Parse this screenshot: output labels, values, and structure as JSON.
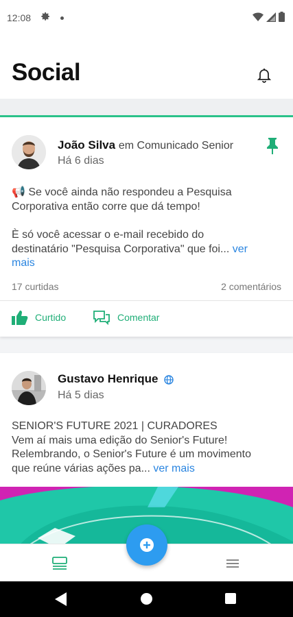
{
  "status_bar": {
    "time": "12:08"
  },
  "header": {
    "title": "Social"
  },
  "posts": [
    {
      "author": "João Silva",
      "context": "em Comunicado Senior",
      "time": "Há 6 dias",
      "text_line1": "📢 Se você ainda não respondeu a Pesquisa",
      "text_line2": "Corporativa então corre que dá tempo!",
      "text_line3": "È só você acessar o e-mail recebido do",
      "text_line4": "destinatário \"Pesquisa Corporativa\" que foi...",
      "see_more_a": "ver",
      "see_more_b": "mais",
      "likes": "17 curtidas",
      "comments": "2 comentários",
      "like_label": "Curtido",
      "comment_label": "Comentar"
    },
    {
      "author": "Gustavo Henrique",
      "time": "Há 5 dias",
      "text_line1": "SENIOR'S FUTURE 2021 | CURADORES",
      "text_line2": "Vem aí mais uma edição do Senior's Future!",
      "text_line3": "Relembrando, o Senior's Future é um movimento",
      "text_line4": "que reúne várias ações pa...",
      "see_more": "ver mais"
    }
  ],
  "colors": {
    "accent": "#2bc28a",
    "link": "#2a85e0",
    "fab": "#2d9cf0",
    "banner": "#d023b3"
  },
  "icons": {
    "status": [
      "gear-icon",
      "wifi-icon",
      "signal-icon",
      "battery-icon"
    ],
    "header": "bell-icon",
    "post": [
      "pin-icon",
      "verified-globe-icon",
      "thumbs-up-icon",
      "comment-icon"
    ],
    "nav": [
      "feed-icon",
      "plus-icon",
      "menu-icon"
    ]
  }
}
